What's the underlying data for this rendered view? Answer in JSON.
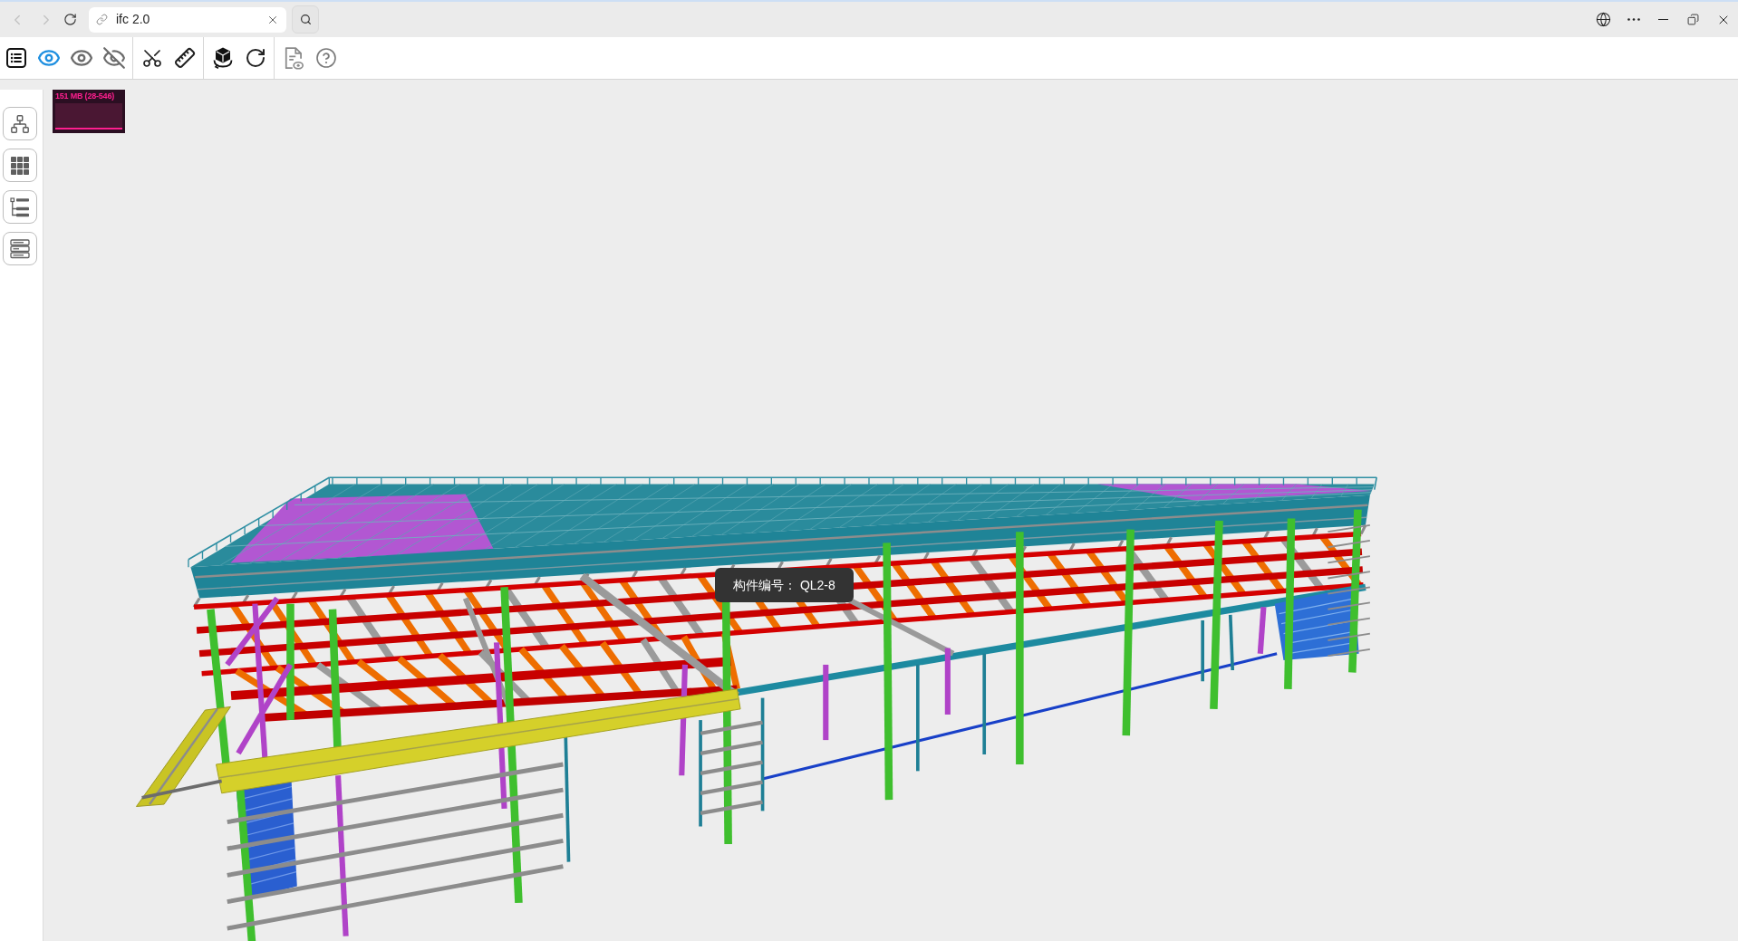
{
  "browser": {
    "nav_buttons": [
      {
        "kind": "back",
        "disabled": true
      },
      {
        "kind": "forward",
        "disabled": true
      },
      {
        "kind": "reload",
        "disabled": false
      }
    ],
    "tab": {
      "title": "ifc 2.0"
    },
    "window_controls": [
      {
        "kind": "globe"
      },
      {
        "kind": "more"
      },
      {
        "kind": "minimize"
      },
      {
        "kind": "restore"
      },
      {
        "kind": "close"
      }
    ]
  },
  "toolbar": {
    "groups": [
      {
        "items": [
          {
            "kind": "list",
            "selected": false
          },
          {
            "kind": "show",
            "selected": true
          },
          {
            "kind": "show",
            "selected": false
          },
          {
            "kind": "hide",
            "selected": false
          }
        ]
      },
      {
        "items": [
          {
            "kind": "cut",
            "selected": false
          },
          {
            "kind": "measure",
            "selected": false
          }
        ]
      },
      {
        "items": [
          {
            "kind": "orbit",
            "selected": false
          },
          {
            "kind": "reset",
            "selected": false
          }
        ]
      },
      {
        "items": [
          {
            "kind": "report",
            "selected": false
          },
          {
            "kind": "help",
            "selected": false
          }
        ]
      }
    ]
  },
  "sidebar": {
    "buttons": [
      {
        "kind": "hierarchy"
      },
      {
        "kind": "grid"
      },
      {
        "kind": "tree"
      },
      {
        "kind": "rows"
      }
    ]
  },
  "viewport": {
    "memory_monitor": {
      "reading": "151 MB (28-546)"
    },
    "tooltip": {
      "text": "构件编号： QL2-8"
    }
  }
}
